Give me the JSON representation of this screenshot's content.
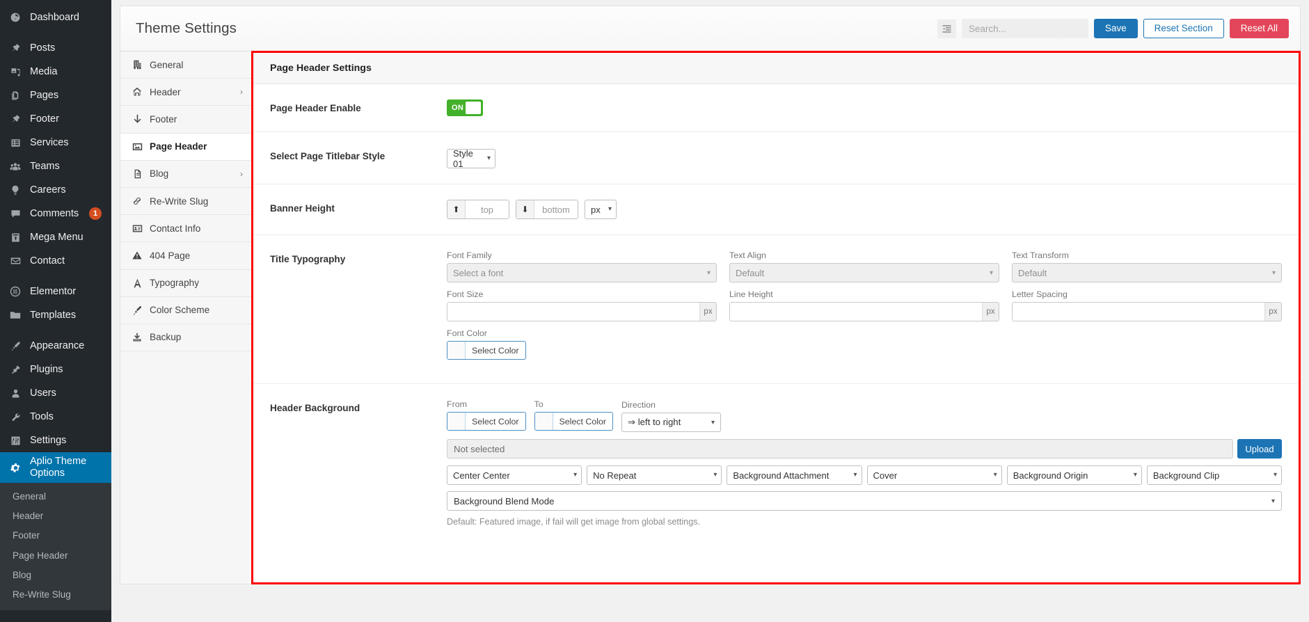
{
  "wp_sidebar": {
    "items": [
      {
        "label": "Dashboard",
        "icon": "dashboard-icon",
        "gap_after": true
      },
      {
        "label": "Posts",
        "icon": "pin-icon"
      },
      {
        "label": "Media",
        "icon": "media-icon"
      },
      {
        "label": "Pages",
        "icon": "pages-icon"
      },
      {
        "label": "Footer",
        "icon": "pin-icon"
      },
      {
        "label": "Services",
        "icon": "list-icon"
      },
      {
        "label": "Teams",
        "icon": "users-group-icon"
      },
      {
        "label": "Careers",
        "icon": "lightbulb-icon"
      },
      {
        "label": "Comments",
        "icon": "comment-icon",
        "badge": "1"
      },
      {
        "label": "Mega Menu",
        "icon": "megamenu-icon"
      },
      {
        "label": "Contact",
        "icon": "email-icon",
        "gap_after": true
      },
      {
        "label": "Elementor",
        "icon": "elementor-icon"
      },
      {
        "label": "Templates",
        "icon": "folder-icon",
        "gap_after": true
      },
      {
        "label": "Appearance",
        "icon": "brush-icon"
      },
      {
        "label": "Plugins",
        "icon": "plug-icon"
      },
      {
        "label": "Users",
        "icon": "user-icon"
      },
      {
        "label": "Tools",
        "icon": "wrench-icon"
      },
      {
        "label": "Settings",
        "icon": "sliders-icon"
      }
    ],
    "active_item": {
      "label": "Aplio Theme Options",
      "icon": "gear-icon"
    },
    "submenu": [
      {
        "label": "General"
      },
      {
        "label": "Header"
      },
      {
        "label": "Footer"
      },
      {
        "label": "Page Header"
      },
      {
        "label": "Blog"
      },
      {
        "label": "Re-Write Slug"
      }
    ]
  },
  "header": {
    "title": "Theme Settings",
    "collapse_icon": "collapse-panel-icon",
    "search_placeholder": "Search...",
    "search_value": "",
    "save_label": "Save",
    "reset_section_label": "Reset Section",
    "reset_all_label": "Reset All"
  },
  "settings_nav": {
    "items": [
      {
        "label": "General",
        "icon": "building-icon",
        "chevron": false
      },
      {
        "label": "Header",
        "icon": "home-icon",
        "chevron": true
      },
      {
        "label": "Footer",
        "icon": "arrow-down-icon",
        "chevron": false
      },
      {
        "label": "Page Header",
        "icon": "image-icon",
        "chevron": false,
        "active": true
      },
      {
        "label": "Blog",
        "icon": "document-icon",
        "chevron": true
      },
      {
        "label": "Re-Write Slug",
        "icon": "link-icon",
        "chevron": false
      },
      {
        "label": "Contact Info",
        "icon": "id-card-icon",
        "chevron": false
      },
      {
        "label": "404 Page",
        "icon": "warning-icon",
        "chevron": false
      },
      {
        "label": "Typography",
        "icon": "letter-a-icon",
        "chevron": false
      },
      {
        "label": "Color Scheme",
        "icon": "paintbrush-icon",
        "chevron": false
      },
      {
        "label": "Backup",
        "icon": "download-icon",
        "chevron": false
      }
    ]
  },
  "content": {
    "section_title": "Page Header Settings",
    "page_header_enable": {
      "label": "Page Header Enable",
      "toggle_state": "ON"
    },
    "titlebar_style": {
      "label": "Select Page Titlebar Style",
      "value": "Style 01"
    },
    "banner_height": {
      "label": "Banner Height",
      "top_placeholder": "top",
      "top_value": "",
      "bottom_placeholder": "bottom",
      "bottom_value": "",
      "unit": "px"
    },
    "title_typography": {
      "label": "Title Typography",
      "font_family_label": "Font Family",
      "font_family_value": "Select a font",
      "text_align_label": "Text Align",
      "text_align_value": "Default",
      "text_transform_label": "Text Transform",
      "text_transform_value": "Default",
      "font_size_label": "Font Size",
      "font_size_value": "",
      "font_size_unit": "px",
      "line_height_label": "Line Height",
      "line_height_value": "",
      "line_height_unit": "px",
      "letter_spacing_label": "Letter Spacing",
      "letter_spacing_value": "",
      "letter_spacing_unit": "px",
      "font_color_label": "Font Color",
      "font_color_button": "Select Color"
    },
    "header_background": {
      "label": "Header Background",
      "from_label": "From",
      "from_button": "Select Color",
      "to_label": "To",
      "to_button": "Select Color",
      "direction_label": "Direction",
      "direction_value": "⇒ left to right",
      "image_value": "Not selected",
      "upload_label": "Upload",
      "position_value": "Center Center",
      "repeat_value": "No Repeat",
      "attachment_value": "Background Attachment",
      "size_value": "Cover",
      "origin_value": "Background Origin",
      "clip_value": "Background Clip",
      "blend_value": "Background Blend Mode",
      "hint": "Default: Featured image, if fail will get image from global settings."
    }
  },
  "colors": {
    "wp_sidebar_bg": "#23282d",
    "wp_active_blue": "#0073aa",
    "toggle_green": "#43b02a",
    "save_blue": "#1c74b4",
    "reset_red": "#e3465a",
    "highlight_border": "#ff0000"
  }
}
